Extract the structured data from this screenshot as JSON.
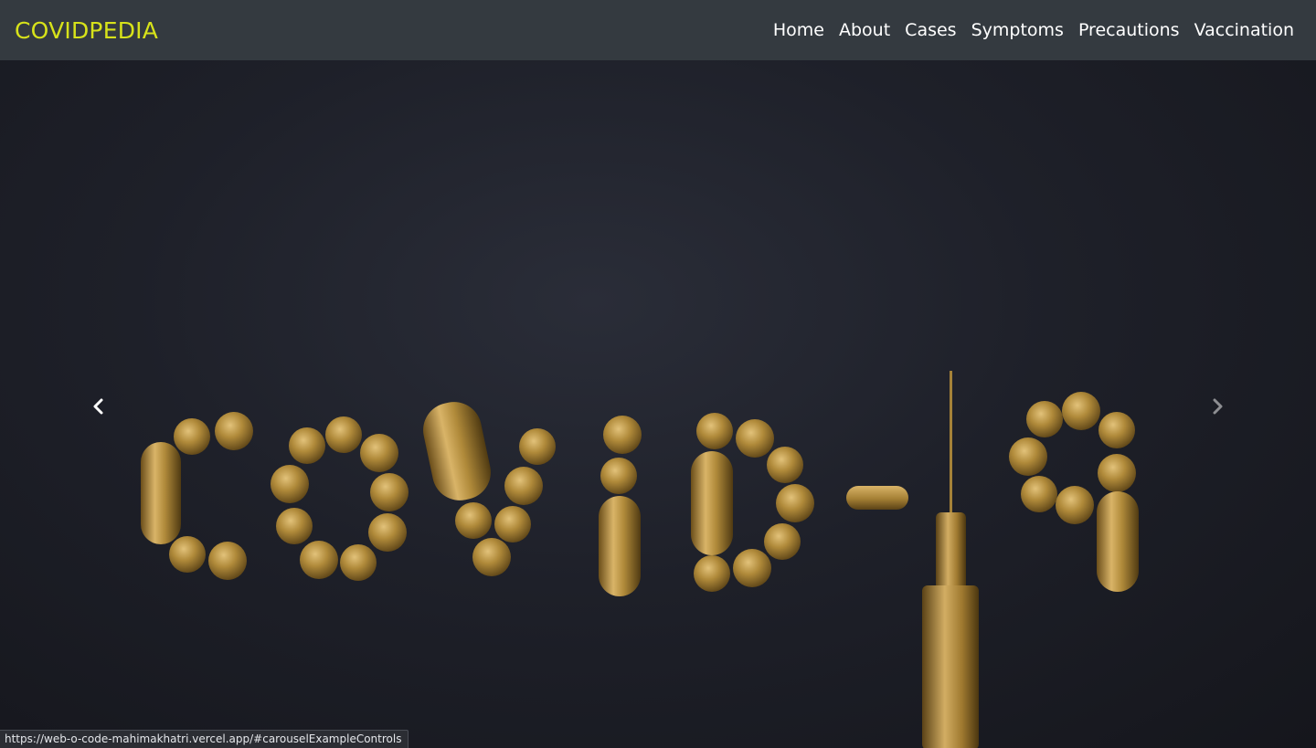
{
  "navbar": {
    "brand": "COVIDPEDIA",
    "links": [
      {
        "label": "Home"
      },
      {
        "label": "About"
      },
      {
        "label": "Cases"
      },
      {
        "label": "Symptoms"
      },
      {
        "label": "Precautions"
      },
      {
        "label": "Vaccination"
      }
    ]
  },
  "carousel": {
    "image_text": "covid-19",
    "prev_icon": "chevron-left-icon",
    "next_icon": "chevron-right-icon"
  },
  "status_bar": {
    "url": "https://web-o-code-mahimakhatri.vercel.app/#carouselExampleControls"
  },
  "colors": {
    "navbar_bg": "#343a40",
    "brand": "#d7e21a",
    "nav_link": "#ffffff",
    "pill_gold": "#b08a3a"
  }
}
